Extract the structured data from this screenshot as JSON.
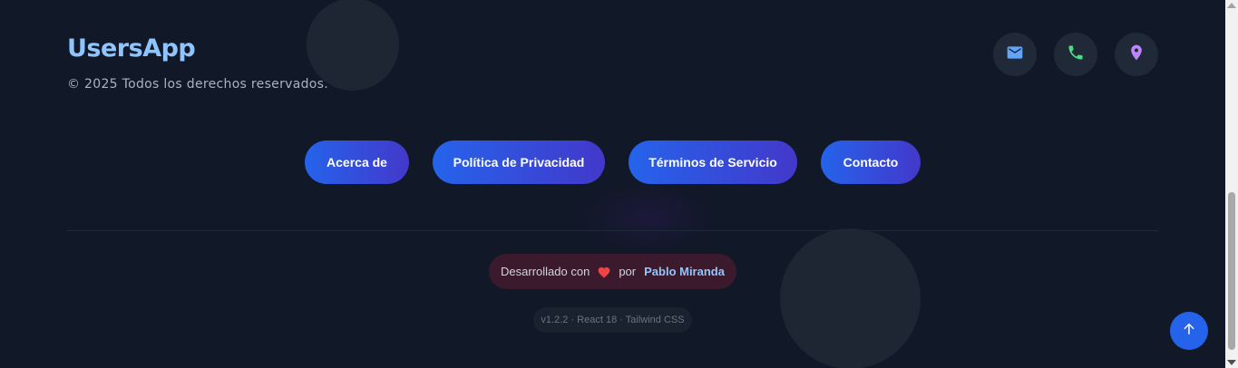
{
  "brand": {
    "name": "UsersApp",
    "copyright": "© 2025 Todos los derechos reservados."
  },
  "contact_icons": [
    {
      "icon": "mail-icon",
      "color": "#60a5fa"
    },
    {
      "icon": "phone-icon",
      "color": "#4ade80"
    },
    {
      "icon": "map-pin-icon",
      "color": "#c084fc"
    }
  ],
  "nav": {
    "about": "Acerca de",
    "privacy": "Política de Privacidad",
    "terms": "Términos de Servicio",
    "contact": "Contacto"
  },
  "credit": {
    "prefix": "Desarrollado con",
    "heart": "heart-icon",
    "by": "por",
    "author": "Pablo Miranda"
  },
  "version": "v1.2.2 · React 18 · Tailwind CSS",
  "scroll_top": {
    "icon": "arrow-up-icon"
  },
  "colors": {
    "background": "#111827",
    "brand": "#8ec5ff",
    "button_start": "#2563eb",
    "button_end": "#4338ca",
    "heart": "#ef4444"
  }
}
